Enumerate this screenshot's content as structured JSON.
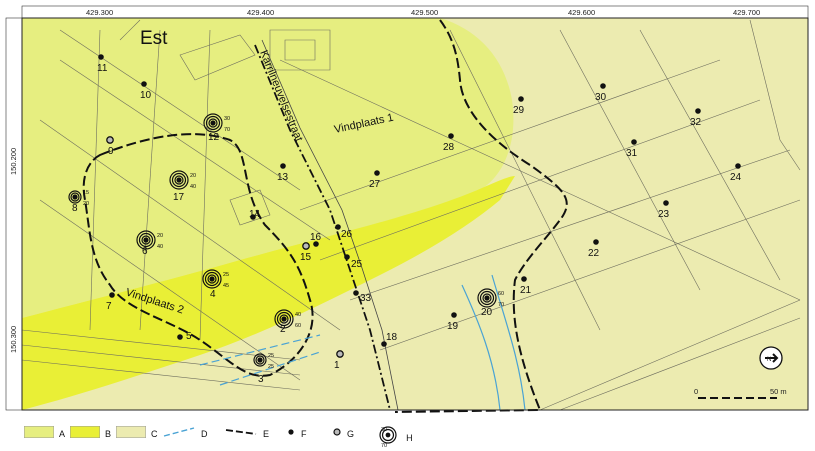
{
  "map": {
    "title": "Est",
    "street": "Karrilneuvelsestraat",
    "zones": [
      "Vindplaats 1",
      "Vindplaats 2"
    ],
    "top_ticks": [
      "429.300",
      "429.400",
      "429.500",
      "429.600",
      "429.700"
    ],
    "left_ticks": [
      "150.200",
      "150.300"
    ],
    "scale": {
      "start": "0",
      "end": "50 m"
    }
  },
  "points": [
    {
      "id": "1",
      "kind": "G"
    },
    {
      "id": "2",
      "kind": "H",
      "v1": "40",
      "v2": "60"
    },
    {
      "id": "3",
      "kind": "H",
      "v1": "25",
      "v2": "25"
    },
    {
      "id": "4",
      "kind": "H",
      "v1": "25",
      "v2": "45"
    },
    {
      "id": "5",
      "kind": "F"
    },
    {
      "id": "6",
      "kind": "H",
      "v1": "20",
      "v2": "40"
    },
    {
      "id": "7",
      "kind": "F"
    },
    {
      "id": "8",
      "kind": "H",
      "v1": "15",
      "v2": "20"
    },
    {
      "id": "9",
      "kind": "G"
    },
    {
      "id": "10",
      "kind": "F"
    },
    {
      "id": "11",
      "kind": "F"
    },
    {
      "id": "12",
      "kind": "H",
      "v1": "30",
      "v2": "70"
    },
    {
      "id": "13",
      "kind": "F"
    },
    {
      "id": "14",
      "kind": "F"
    },
    {
      "id": "15",
      "kind": "G"
    },
    {
      "id": "16",
      "kind": "F"
    },
    {
      "id": "17",
      "kind": "H",
      "v1": "20",
      "v2": "40"
    },
    {
      "id": "18",
      "kind": "F"
    },
    {
      "id": "19",
      "kind": "F"
    },
    {
      "id": "20",
      "kind": "H",
      "v1": "60",
      "v2": "70"
    },
    {
      "id": "21",
      "kind": "F"
    },
    {
      "id": "22",
      "kind": "F"
    },
    {
      "id": "23",
      "kind": "F"
    },
    {
      "id": "24",
      "kind": "F"
    },
    {
      "id": "25",
      "kind": "F"
    },
    {
      "id": "26",
      "kind": "F"
    },
    {
      "id": "27",
      "kind": "F"
    },
    {
      "id": "28",
      "kind": "F"
    },
    {
      "id": "29",
      "kind": "F"
    },
    {
      "id": "30",
      "kind": "F"
    },
    {
      "id": "31",
      "kind": "F"
    },
    {
      "id": "32",
      "kind": "F"
    },
    {
      "id": "33",
      "kind": "F"
    }
  ],
  "legend": {
    "items": [
      {
        "key": "A"
      },
      {
        "key": "B"
      },
      {
        "key": "C"
      },
      {
        "key": "D"
      },
      {
        "key": "E"
      },
      {
        "key": "F"
      },
      {
        "key": "G"
      },
      {
        "key": "H",
        "v1": "30",
        "v2": "70"
      }
    ]
  },
  "colors": {
    "zone_a": "#e6ee80",
    "zone_b": "#e9ef36",
    "zone_c": "#ecebb0",
    "ditch": "#4aa3d4",
    "outline": "#111111"
  }
}
